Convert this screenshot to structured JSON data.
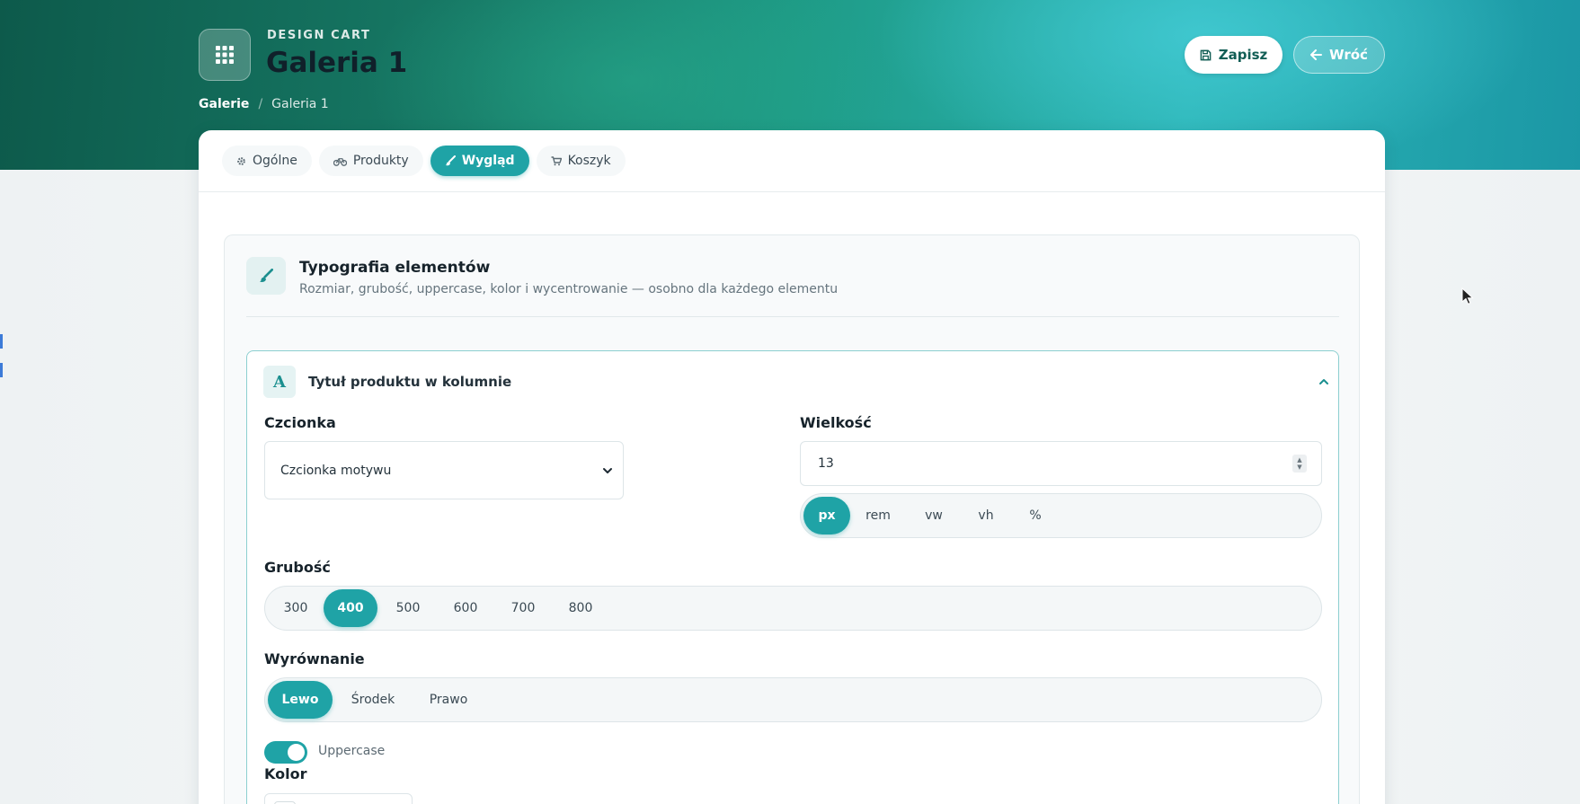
{
  "header": {
    "app_subtitle": "DESIGN CART",
    "title": "Galeria 1",
    "breadcrumb": {
      "root": "Galerie",
      "separator": "/",
      "current": "Galeria 1"
    },
    "save_label": "Zapisz",
    "back_label": "Wróć"
  },
  "tabs": [
    {
      "label": "Ogólne",
      "icon": "gear-icon"
    },
    {
      "label": "Produkty",
      "icon": "bicycle-icon"
    },
    {
      "label": "Wygląd",
      "icon": "brush-icon",
      "active": true
    },
    {
      "label": "Koszyk",
      "icon": "cart-icon"
    }
  ],
  "section": {
    "title": "Typografia elementów",
    "description": "Rozmiar, grubość, uppercase, kolor i wycentrowanie — osobno dla każdego elementu"
  },
  "panel": {
    "letter": "A",
    "title": "Tytuł produktu w kolumnie",
    "font": {
      "label": "Czcionka",
      "value": "Czcionka motywu"
    },
    "size": {
      "label": "Wielkość",
      "value": "13",
      "units": [
        "px",
        "rem",
        "vw",
        "vh",
        "%"
      ],
      "selected_unit": "px"
    },
    "weight": {
      "label": "Grubość",
      "options": [
        "300",
        "400",
        "500",
        "600",
        "700",
        "800"
      ],
      "selected": "400"
    },
    "align": {
      "label": "Wyrównanie",
      "options": [
        "Lewo",
        "Środek",
        "Prawo"
      ],
      "selected": "Lewo"
    },
    "uppercase": {
      "label": "Uppercase",
      "on": true
    },
    "color": {
      "label": "Kolor"
    }
  },
  "colors": {
    "accent": "#1fa3a6",
    "header_dark": "#0d5a4b",
    "header_light": "#2bb4b5"
  }
}
